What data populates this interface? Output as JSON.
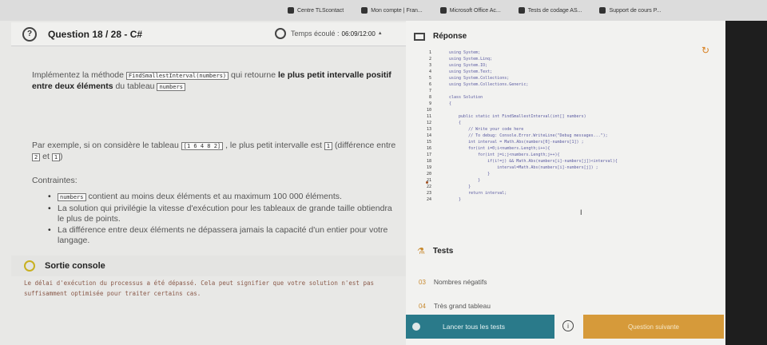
{
  "bookmarks": [
    {
      "label": "Centre TLScontact"
    },
    {
      "label": "Mon compte | Fran..."
    },
    {
      "label": "Microsoft Office Ac..."
    },
    {
      "label": "Tests de codage AS..."
    },
    {
      "label": "Support de cours P..."
    }
  ],
  "header": {
    "question": "Question 18 / 28 - C#",
    "timer_label": "Temps écoulé :",
    "timer_value": "06:09/12:00"
  },
  "statement": {
    "p1_a": "Implémentez la méthode",
    "p1_code": "FindSmallestInterval(numbers)",
    "p1_b": "qui retourne",
    "p1_bold": "le plus petit intervalle positif entre deux éléments",
    "p1_c": "du tableau",
    "p1_code2": "numbers",
    "p2_a": "Par exemple, si on considère le tableau",
    "p2_code": "[1 6 4 8 2]",
    "p2_b": ", le plus petit intervalle est",
    "p2_code2": "1",
    "p2_c": "(différence entre",
    "p2_code3": "2",
    "p2_d": "et",
    "p2_code4": "1",
    "p2_e": ")",
    "constraints_label": "Contraintes:",
    "c1_code": "numbers",
    "c1_text": "contient au moins deux éléments et au maximum 100 000 éléments.",
    "c2_text": "La solution qui privilégie la vitesse d'exécution pour les tableaux de grande taille obtiendra le plus de points.",
    "c3_text": "La différence entre deux éléments ne dépassera jamais la capacité d'un entier pour votre langage."
  },
  "output": {
    "title": "Sortie console",
    "text": "Le délai d'exécution du processus a été dépassé. Cela peut signifier que votre solution n'est pas suffisamment optimisée pour traiter certains cas."
  },
  "response": {
    "title": "Réponse"
  },
  "code_lines": [
    {
      "n": "1",
      "t": "using System;"
    },
    {
      "n": "2",
      "t": "using System.Linq;"
    },
    {
      "n": "3",
      "t": "using System.IO;"
    },
    {
      "n": "4",
      "t": "using System.Text;"
    },
    {
      "n": "5",
      "t": "using System.Collections;"
    },
    {
      "n": "6",
      "t": "using System.Collections.Generic;"
    },
    {
      "n": "7",
      "t": ""
    },
    {
      "n": "8",
      "t": "class Solution"
    },
    {
      "n": "9",
      "t": "{"
    },
    {
      "n": "10",
      "t": ""
    },
    {
      "n": "11",
      "t": "    public static int FindSmallestInterval(int[] numbers)"
    },
    {
      "n": "12",
      "t": "    {"
    },
    {
      "n": "13",
      "t": "        // Write your code here"
    },
    {
      "n": "14",
      "t": "        // To debug: Console.Error.WriteLine(\"Debug messages...\");"
    },
    {
      "n": "15",
      "t": "        int interval = Math.Abs(numbers[0]-numbers[1]) ;"
    },
    {
      "n": "16",
      "t": "        for(int i=0;i<numbers.Length;i++){"
    },
    {
      "n": "17",
      "t": "            for(int j=i;j<numbers.Length;j++){"
    },
    {
      "n": "18",
      "t": "                if(i!=j) && Math.Abs(numbers[i]-numbers[j])<interval){"
    },
    {
      "n": "19",
      "t": "                    interval=Math.Abs(numbers[i]-numbers[j]) ;"
    },
    {
      "n": "20",
      "t": "                }"
    },
    {
      "n": "21",
      "t": "            }"
    },
    {
      "n": "22",
      "t": "        }"
    },
    {
      "n": "23",
      "t": "        return interval;"
    },
    {
      "n": "24",
      "t": "    }"
    }
  ],
  "tests": {
    "title": "Tests",
    "items": [
      {
        "num": "03",
        "label": "Nombres négatifs"
      },
      {
        "num": "04",
        "label": "Très grand tableau"
      }
    ],
    "run_label": "Lancer tous les tests",
    "info_label": "i",
    "next_label": "Question suivante"
  },
  "colors": {
    "run_button": "#2a7a8a",
    "next_button": "#d69a3a",
    "accent": "#c88a30"
  }
}
